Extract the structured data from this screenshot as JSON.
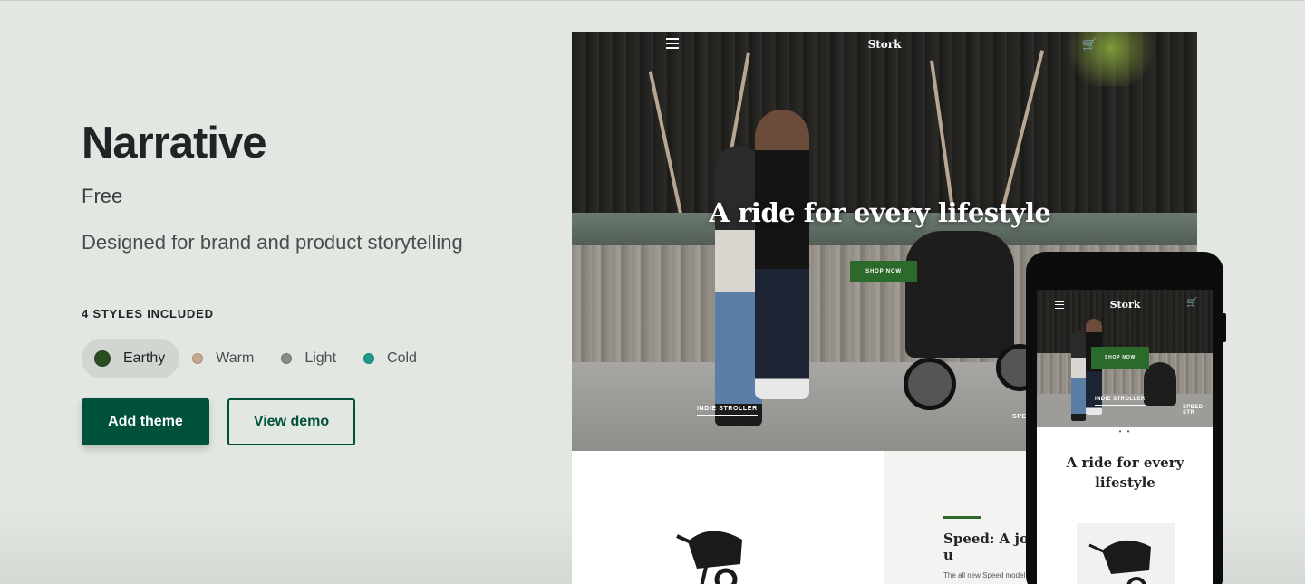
{
  "theme": {
    "name": "Narrative",
    "price": "Free",
    "description": "Designed for brand and product storytelling",
    "styles_heading": "4 STYLES INCLUDED"
  },
  "styles": [
    {
      "label": "Earthy",
      "color": "#2a4d24",
      "selected": true
    },
    {
      "label": "Warm",
      "color": "#c4a98f",
      "selected": false
    },
    {
      "label": "Light",
      "color": "#8a8a8a",
      "selected": false
    },
    {
      "label": "Cold",
      "color": "#1d9b86",
      "selected": false
    }
  ],
  "actions": {
    "add_theme": "Add theme",
    "view_demo": "View demo"
  },
  "preview": {
    "desktop": {
      "brand": "Stork",
      "hero_title": "A ride for every lifestyle",
      "shop_now": "SHOP NOW",
      "indie_link": "INDIE STROLLER",
      "speed_link": "SPEE",
      "feature_title": "Speed: A jog that keeps u",
      "feature_desc": "The all new Speed model"
    },
    "mobile": {
      "brand": "Stork",
      "shop_now": "SHOP NOW",
      "indie_link": "INDIE STROLLER",
      "speed_link": "SPEED STR",
      "slider_dots": "• •",
      "title": "A ride for every lifestyle"
    }
  },
  "colors": {
    "background": "#e2e7e1",
    "primary": "#00513b",
    "preview_accent": "#2c6a2b"
  },
  "icons": {
    "menu": "hamburger-icon",
    "cart": "cart-icon"
  }
}
